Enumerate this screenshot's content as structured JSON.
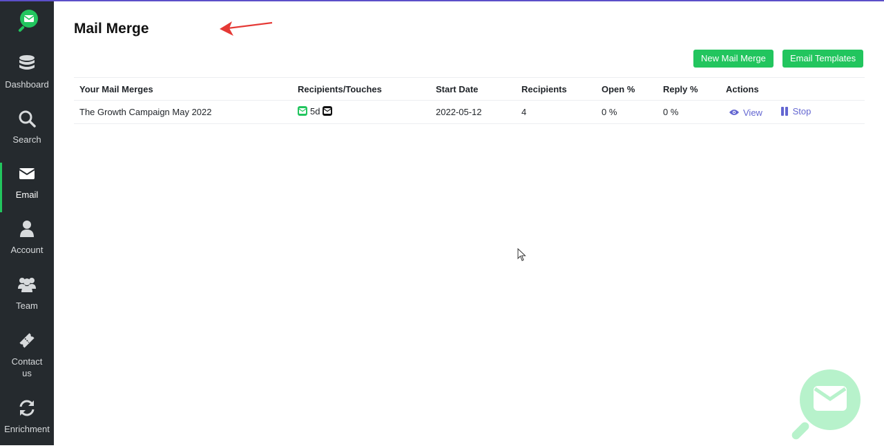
{
  "sidebar": {
    "items": [
      {
        "label": "Dashboard",
        "icon": "database-icon"
      },
      {
        "label": "Search",
        "icon": "search-icon"
      },
      {
        "label": "Email",
        "icon": "envelope-icon",
        "active": true
      },
      {
        "label": "Account",
        "icon": "user-icon"
      },
      {
        "label": "Team",
        "icon": "users-icon"
      },
      {
        "label": "Contact us",
        "icon": "ticket-icon"
      },
      {
        "label": "Enrichment",
        "icon": "refresh-icon"
      }
    ]
  },
  "header": {
    "title": "Mail Merge"
  },
  "toolbar": {
    "new_label": "New Mail Merge",
    "templates_label": "Email Templates"
  },
  "table": {
    "headers": [
      "Your Mail Merges",
      "Recipients/Touches",
      "Start Date",
      "Recipients",
      "Open %",
      "Reply %",
      "Actions"
    ],
    "rows": [
      {
        "name": "The Growth Campaign May 2022",
        "touch_delay": "5d",
        "start_date": "2022-05-12",
        "recipients": "4",
        "open": "0 %",
        "reply": "0 %",
        "view_label": "View",
        "stop_label": "Stop"
      }
    ]
  },
  "colors": {
    "accent": "#22c55e",
    "sidebar": "#252a2e",
    "action": "#6366d1",
    "top_line": "#5b4fc9"
  }
}
